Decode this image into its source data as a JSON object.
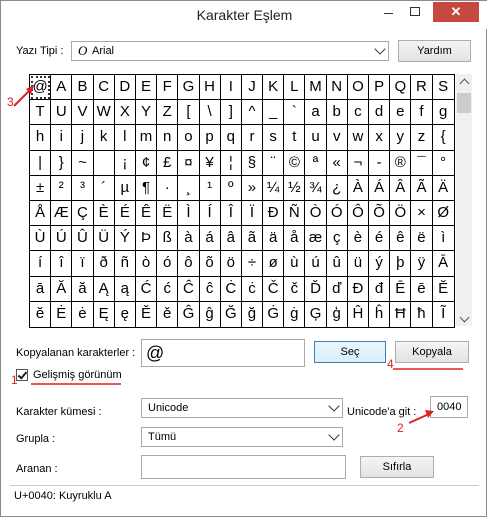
{
  "window": {
    "title": "Karakter Eşlem",
    "close_glyph": "✕"
  },
  "font_row": {
    "label": "Yazı Tipi :",
    "font_icon_glyph": "O",
    "font_value": "Arial",
    "help_button": "Yardım"
  },
  "grid_rows": [
    [
      "@",
      "A",
      "B",
      "C",
      "D",
      "E",
      "F",
      "G",
      "H",
      "I",
      "J",
      "K",
      "L",
      "M",
      "N",
      "O",
      "P",
      "Q",
      "R",
      "S"
    ],
    [
      "T",
      "U",
      "V",
      "W",
      "X",
      "Y",
      "Z",
      "[",
      "\\",
      "]",
      "^",
      "_",
      "`",
      "a",
      "b",
      "c",
      "d",
      "e",
      "f",
      "g"
    ],
    [
      "h",
      "i",
      "j",
      "k",
      "l",
      "m",
      "n",
      "o",
      "p",
      "q",
      "r",
      "s",
      "t",
      "u",
      "v",
      "w",
      "x",
      "y",
      "z",
      "{"
    ],
    [
      "|",
      "}",
      "~",
      " ",
      "¡",
      "¢",
      "£",
      "¤",
      "¥",
      "¦",
      "§",
      "¨",
      "©",
      "ª",
      "«",
      "¬",
      "-",
      "®",
      "¯",
      "°"
    ],
    [
      "±",
      "²",
      "³",
      "´",
      "µ",
      "¶",
      "·",
      "¸",
      "¹",
      "º",
      "»",
      "¼",
      "½",
      "¾",
      "¿",
      "À",
      "Á",
      "Â",
      "Ã",
      "Ä"
    ],
    [
      "Å",
      "Æ",
      "Ç",
      "È",
      "É",
      "Ê",
      "Ë",
      "Ì",
      "Í",
      "Î",
      "Ï",
      "Ð",
      "Ñ",
      "Ò",
      "Ó",
      "Ô",
      "Õ",
      "Ö",
      "×",
      "Ø"
    ],
    [
      "Ù",
      "Ú",
      "Û",
      "Ü",
      "Ý",
      "Þ",
      "ß",
      "à",
      "á",
      "â",
      "ã",
      "ä",
      "å",
      "æ",
      "ç",
      "è",
      "é",
      "ê",
      "ë",
      "ì"
    ],
    [
      "í",
      "î",
      "ï",
      "ð",
      "ñ",
      "ò",
      "ó",
      "ô",
      "õ",
      "ö",
      "÷",
      "ø",
      "ù",
      "ú",
      "û",
      "ü",
      "ý",
      "þ",
      "ÿ",
      "Ā"
    ],
    [
      "ā",
      "Ă",
      "ă",
      "Ą",
      "ą",
      "Ć",
      "ć",
      "Ĉ",
      "ĉ",
      "Ċ",
      "ċ",
      "Č",
      "č",
      "Ď",
      "ď",
      "Đ",
      "đ",
      "Ē",
      "ē",
      "Ĕ"
    ],
    [
      "ĕ",
      "Ė",
      "ė",
      "Ę",
      "ę",
      "Ě",
      "ě",
      "Ĝ",
      "ĝ",
      "Ğ",
      "ğ",
      "Ġ",
      "ġ",
      "Ģ",
      "ģ",
      "Ĥ",
      "ĥ",
      "Ħ",
      "ħ",
      "Ĩ"
    ]
  ],
  "copy": {
    "label": "Kopyalanan karakterler :",
    "value": "@",
    "select_button": "Seç",
    "copy_button": "Kopyala"
  },
  "advanced": {
    "label": "Gelişmiş görünüm",
    "checked": true
  },
  "charset": {
    "label": "Karakter kümesi :",
    "value": "Unicode"
  },
  "unicode_goto": {
    "label": "Unicode'a git :",
    "value": "0040"
  },
  "group": {
    "label": "Grupla :",
    "value": "Tümü"
  },
  "search": {
    "label": "Aranan :",
    "value": "",
    "reset_button": "Sıfırla"
  },
  "status": {
    "text": "U+0040: Kuyruklu A"
  },
  "annotations": [
    "1",
    "2",
    "3",
    "4"
  ],
  "colors": {
    "annotation": "#dd2222",
    "close": "#c7483f"
  }
}
